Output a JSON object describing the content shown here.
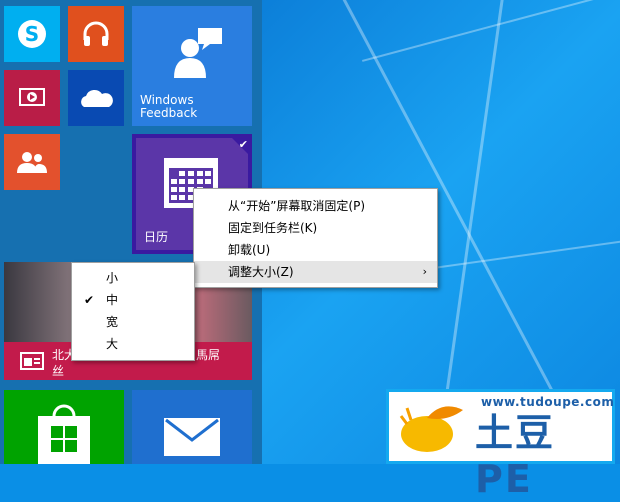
{
  "tiles": {
    "skype": {
      "icon": "skype-icon",
      "color": "#00aff0"
    },
    "music": {
      "icon": "headphones-icon",
      "color": "#e0501e"
    },
    "feedback": {
      "label": "Windows Feedback",
      "color": "#2a7ee0"
    },
    "video": {
      "icon": "video-icon",
      "color": "#b91d47"
    },
    "onedrive": {
      "icon": "cloud-icon",
      "color": "#094ab2"
    },
    "people": {
      "icon": "people-icon",
      "color": "#e3512d"
    },
    "calendar": {
      "label": "日历",
      "color": "#5b36a8",
      "selected": true
    },
    "news": {
      "label_left": "北大",
      "label_right": "馬屌",
      "label_line2": "丝",
      "color": "#c21b4b"
    },
    "store": {
      "color": "#00a300"
    },
    "mail": {
      "color": "#1f6fcf"
    }
  },
  "context_menu": {
    "items": [
      {
        "label": "从“开始”屏幕取消固定(P)"
      },
      {
        "label": "固定到任务栏(K)"
      },
      {
        "label": "卸载(U)"
      },
      {
        "label": "调整大小(Z)",
        "submenu_arrow": "›",
        "highlighted": true
      }
    ]
  },
  "resize_submenu": {
    "items": [
      {
        "label": "小",
        "checked": false
      },
      {
        "label": "中",
        "checked": true,
        "check": "✔"
      },
      {
        "label": "宽",
        "checked": false
      },
      {
        "label": "大",
        "checked": false
      }
    ]
  },
  "watermark": {
    "url": "www.tudoupe.com",
    "brand": "土豆PE"
  }
}
